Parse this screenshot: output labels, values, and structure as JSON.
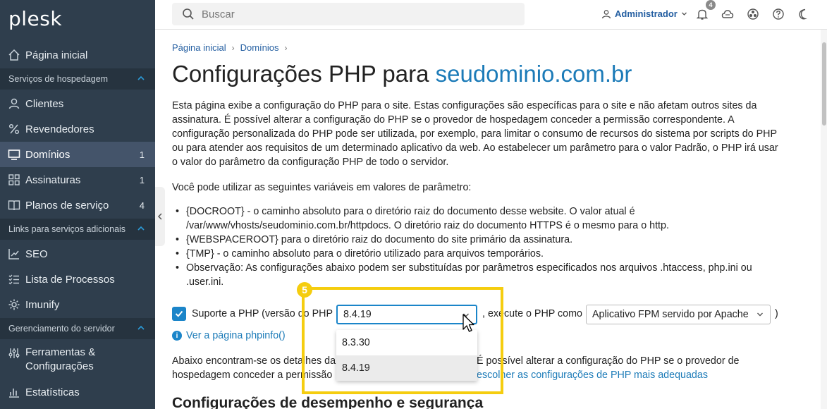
{
  "sidebar": {
    "logo": "plesk",
    "home": "Página inicial",
    "section_hosting": "Serviços de hospedagem",
    "clients": "Clientes",
    "resellers": "Revendedores",
    "domains": "Domínios",
    "domains_count": "1",
    "subscriptions": "Assinaturas",
    "subscriptions_count": "1",
    "service_plans": "Planos de serviço",
    "service_plans_count": "4",
    "section_links": "Links para serviços adicionais",
    "seo": "SEO",
    "process_list": "Lista de Processos",
    "imunify": "Imunify",
    "section_server": "Gerenciamento do servidor",
    "tools": "Ferramentas &",
    "tools_line2": "Configurações",
    "stats": "Estatísticas"
  },
  "topbar": {
    "search_placeholder": "Buscar",
    "user": "Administrador",
    "notifications_count": "4"
  },
  "breadcrumb": {
    "home": "Página inicial",
    "domains": "Domínios"
  },
  "page": {
    "title_prefix": "Configurações PHP para ",
    "title_domain": "seudominio.com.br",
    "intro_1": "Esta página exibe a configuração do PHP para o site. Estas configurações são específicas para o site e não afetam outros sites da",
    "intro_2": "assinatura. É possível alterar a configuração do PHP se o provedor de hospedagem conceder a permissão correspondente. A",
    "intro_3": "configuração personalizada do PHP pode ser utilizada, por exemplo, para limitar o consumo de recursos do sistema por scripts do PHP",
    "intro_4": "ou para atender aos requisitos de um determinado aplicativo da web. Ao estabelecer um parâmetro para o valor Padrão, o PHP irá usar",
    "intro_5": "o valor do parâmetro da configuração PHP de todo o servidor.",
    "variables_intro": "Você pode utilizar as seguintes variáveis em valores de parâmetro:",
    "bullet_1a": "{DOCROOT} - o caminho absoluto para o diretório raiz do documento desse website. O valor atual é",
    "bullet_1b": "/var/www/vhosts/seudominio.com.br/httpdocs. O diretório raiz do documento HTTPS é o mesmo para o http.",
    "bullet_2": "{WEBSPACEROOT} para o diretório raiz do documento do site primário da assinatura.",
    "bullet_3": "{TMP} - o caminho absoluto para o diretório utilizado para arquivos temporários.",
    "bullet_4a": "Observação: As configurações abaixo podem ser substituídas por parâmetros especificados nos arquivos .htaccess, php.ini ou",
    "bullet_4b": ".user.ini.",
    "php_support_label": "Suporte a PHP  (versão do PHP",
    "php_version_selected": "8.4.19",
    "run_as_label": ", execute o PHP como",
    "php_handler": "Aplicativo FPM servido por Apache",
    "close_paren": ")",
    "phpinfo_link": "Ver a página phpinfo()",
    "para3_line1_left": "Abaixo encontram-se os detalhes da",
    "para3_line1_right": "É possível alterar a configuração do PHP se o provedor de",
    "para3_line2_left": "hospedagem conceder a permissão",
    "para3_line2_link": "escolher as configurações de PHP mais adequadas",
    "section_title": "Configurações de desempenho e segurança"
  },
  "php_version_options": [
    "8.3.30",
    "8.4.19"
  ],
  "annotation": {
    "step": "5",
    "color": "#f5cd0f"
  },
  "colors": {
    "sidebar": "#2f3e4d",
    "accent": "#1b85c9",
    "link": "#1c7bb8"
  }
}
